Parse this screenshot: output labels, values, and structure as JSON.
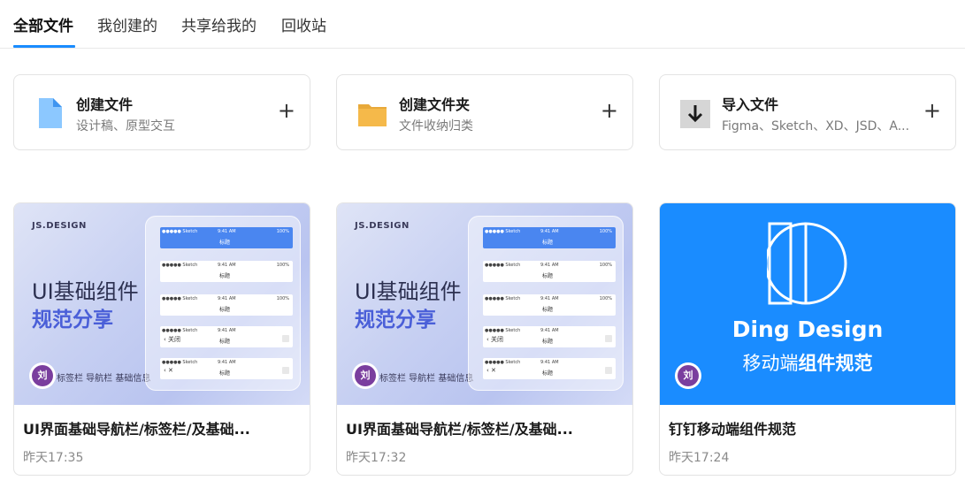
{
  "tabs": [
    {
      "label": "全部文件",
      "active": true
    },
    {
      "label": "我创建的",
      "active": false
    },
    {
      "label": "共享给我的",
      "active": false
    },
    {
      "label": "回收站",
      "active": false
    }
  ],
  "create_actions": [
    {
      "title": "创建文件",
      "subtitle": "设计稿、原型交互",
      "icon": "file-icon",
      "plus": "+"
    },
    {
      "title": "创建文件夹",
      "subtitle": "文件收纳归类",
      "icon": "folder-icon",
      "plus": "+"
    },
    {
      "title": "导入文件",
      "subtitle": "Figma、Sketch、XD、JSD、A...",
      "icon": "import-icon",
      "plus": "+"
    }
  ],
  "files": [
    {
      "name": "UI界面基础导航栏/标签栏/及基础...",
      "time": "昨天17:35",
      "thumb": {
        "brand": "JS.DESIGN",
        "line1": "UI基础组件",
        "line2": "规范分享",
        "footer": "标签栏  导航栏  基础信息",
        "avatar": "刘"
      }
    },
    {
      "name": "UI界面基础导航栏/标签栏/及基础...",
      "time": "昨天17:32",
      "thumb": {
        "brand": "JS.DESIGN",
        "line1": "UI基础组件",
        "line2": "规范分享",
        "footer": "标签栏  导航栏  基础信息",
        "avatar": "刘"
      }
    },
    {
      "name": "钉钉移动端组件规范",
      "time": "昨天17:24",
      "thumb": {
        "title": "Ding Design",
        "subtitle_plain": "移动端",
        "subtitle_bold": "组件规范",
        "avatar": "刘"
      }
    }
  ],
  "mock_phone": {
    "status_left": "●●●●● Sketch",
    "status_time": "9:41 AM",
    "status_battery": "100%",
    "title": "标题",
    "back_close": "‹  关闭",
    "back_x": "‹  ✕"
  },
  "colors": {
    "accent": "#1a8cff",
    "ding_blue": "#1a8cff",
    "avatar_purple": "#7a3e9e",
    "file_icon_blue": "#8cc8ff",
    "folder_yellow": "#f5b94a"
  }
}
